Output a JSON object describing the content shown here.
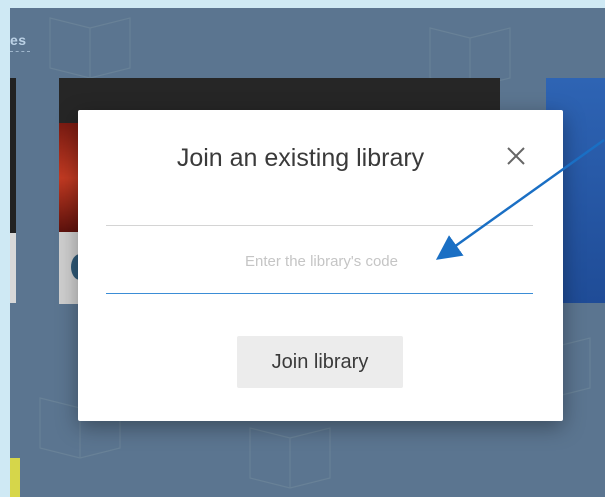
{
  "nav": {
    "label": "es"
  },
  "modal": {
    "title": "Join an existing library",
    "close_icon": "close-icon",
    "code_input": {
      "value": "",
      "placeholder": "Enter the library's code"
    },
    "join_button_label": "Join library"
  },
  "annotation": {
    "arrow_color": "#1a6fc4"
  },
  "colors": {
    "background": "#5b7590",
    "modal": "#ffffff",
    "accent_underline": "#3b8dd6",
    "button": "#ececec"
  }
}
